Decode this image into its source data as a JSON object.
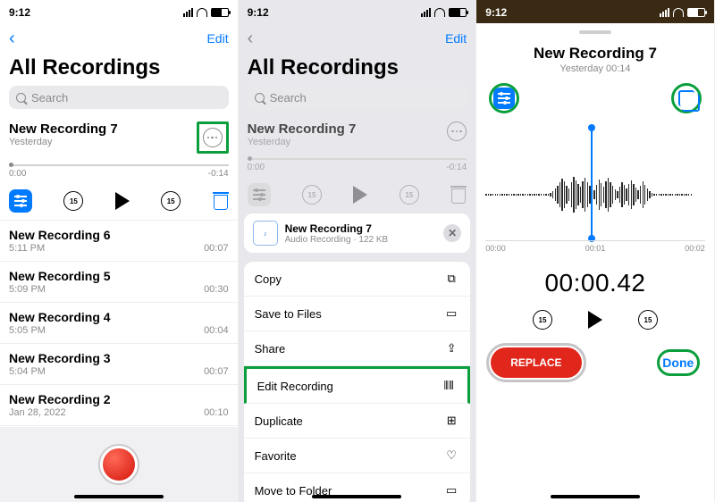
{
  "status": {
    "time": "9:12"
  },
  "nav": {
    "edit": "Edit"
  },
  "title": "All Recordings",
  "search": {
    "placeholder": "Search"
  },
  "current": {
    "title": "New Recording 7",
    "subtitle": "Yesterday",
    "start": "0:00",
    "end": "-0:14"
  },
  "recordings": [
    {
      "title": "New Recording 6",
      "sub": "5:11 PM",
      "dur": "00:07"
    },
    {
      "title": "New Recording 5",
      "sub": "5:09 PM",
      "dur": "00:30"
    },
    {
      "title": "New Recording 4",
      "sub": "5:05 PM",
      "dur": "00:04"
    },
    {
      "title": "New Recording 3",
      "sub": "5:04 PM",
      "dur": "00:07"
    },
    {
      "title": "New Recording 2",
      "sub": "Jan 28, 2022",
      "dur": "00:10"
    }
  ],
  "sheet": {
    "file_title": "New Recording 7",
    "file_sub": "Audio Recording · 122 KB",
    "items": [
      {
        "label": "Copy",
        "icon": "copy-icon"
      },
      {
        "label": "Save to Files",
        "icon": "folder-icon"
      },
      {
        "label": "Share",
        "icon": "share-icon"
      },
      {
        "label": "Edit Recording",
        "icon": "waveform-icon",
        "highlight": true
      },
      {
        "label": "Duplicate",
        "icon": "duplicate-icon"
      },
      {
        "label": "Favorite",
        "icon": "heart-icon"
      },
      {
        "label": "Move to Folder",
        "icon": "folder-icon"
      }
    ]
  },
  "editor": {
    "title": "New Recording 7",
    "sub": "Yesterday  00:14",
    "axis": [
      "00:00",
      "00:01",
      "00:02"
    ],
    "time": "00:00.42",
    "replace": "REPLACE",
    "done": "Done",
    "skip_amount": "15"
  },
  "skip_amount": "15"
}
